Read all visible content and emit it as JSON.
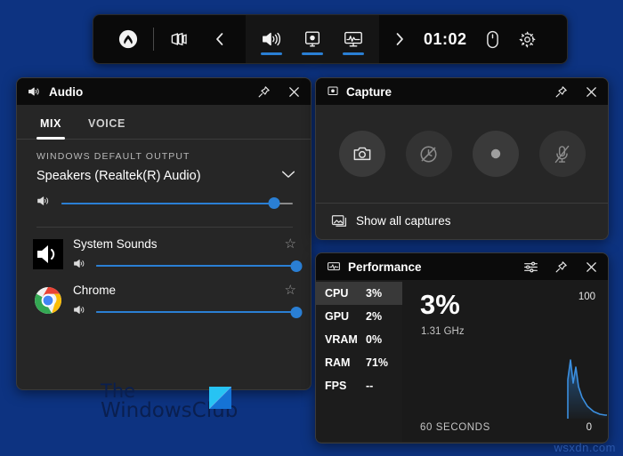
{
  "toolbar": {
    "xbox_label": "Xbox",
    "widgets_label": "Widget menu",
    "back_label": "Back",
    "items": [
      {
        "name": "audio",
        "label": "Audio",
        "active": true
      },
      {
        "name": "capture",
        "label": "Capture",
        "active": true
      },
      {
        "name": "performance",
        "label": "Performance",
        "active": true
      }
    ],
    "forward_label": "Forward",
    "time": "01:02",
    "mouse_label": "Mouse",
    "settings_label": "Settings",
    "accent": "#2a7fd4"
  },
  "audio": {
    "title": "Audio",
    "pin_label": "Pin",
    "close_label": "Close",
    "tabs": [
      {
        "label": "MIX",
        "active": true
      },
      {
        "label": "VOICE",
        "active": false
      }
    ],
    "section_label": "WINDOWS DEFAULT OUTPUT",
    "device": "Speakers (Realtek(R) Audio)",
    "master_volume": 92,
    "apps": [
      {
        "name": "System Sounds",
        "icon": "speaker-icon",
        "volume": 100
      },
      {
        "name": "Chrome",
        "icon": "chrome-icon",
        "volume": 100
      }
    ]
  },
  "capture": {
    "title": "Capture",
    "pin_label": "Pin",
    "close_label": "Close",
    "buttons": [
      {
        "name": "screenshot",
        "icon": "camera-icon",
        "disabled": false
      },
      {
        "name": "record-last-30-seconds",
        "icon": "record-last-disabled-icon",
        "disabled": true
      },
      {
        "name": "start-recording",
        "icon": "record-dot-icon",
        "disabled": false
      },
      {
        "name": "toggle-microphone",
        "icon": "mic-off-icon",
        "disabled": true
      }
    ],
    "show_all_label": "Show all captures"
  },
  "performance": {
    "title": "Performance",
    "settings_label": "Performance options",
    "pin_label": "Pin",
    "close_label": "Close",
    "metrics": [
      {
        "key": "CPU",
        "value": "3%",
        "selected": true
      },
      {
        "key": "GPU",
        "value": "2%",
        "selected": false
      },
      {
        "key": "VRAM",
        "value": "0%",
        "selected": false
      },
      {
        "key": "RAM",
        "value": "71%",
        "selected": false
      },
      {
        "key": "FPS",
        "value": "--",
        "selected": false
      }
    ],
    "big_value": "3%",
    "sub_value": "1.31 GHz",
    "axis_max": "100",
    "axis_min": "0",
    "time_range": "60 SECONDS",
    "graph_color": "#2a7fd4"
  },
  "watermarks": {
    "club_line1": "The",
    "club_line2": "WindowsClub",
    "site": "wsxdn.com"
  }
}
